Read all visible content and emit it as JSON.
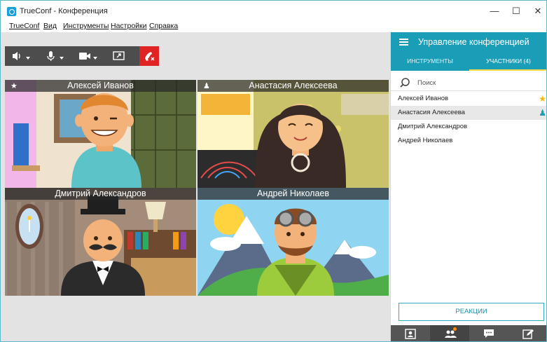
{
  "window": {
    "title": "TrueConf - Конференция",
    "controls": [
      "—",
      "☐",
      "✕"
    ]
  },
  "menu": [
    "TrueConf",
    "Вид",
    "Инструменты",
    "Настройки",
    "Справка"
  ],
  "toolbar": {
    "buttons": [
      "speaker-icon",
      "microphone-icon",
      "camera-icon",
      "screen-share-icon"
    ],
    "hangup": "hangup-icon"
  },
  "tiles": [
    {
      "name": "Алексей Иванов",
      "badge": "★"
    },
    {
      "name": "Анастасия Алексеева",
      "badge": "♟"
    },
    {
      "name": "Дмитрий Александров",
      "badge": ""
    },
    {
      "name": "Андрей Николаев",
      "badge": ""
    }
  ],
  "panel": {
    "title": "Управление конференцией",
    "tabs": [
      {
        "label": "ИНСТРУМЕНТЫ",
        "active": false
      },
      {
        "label": "УЧАСТНИКИ (4)",
        "active": true
      }
    ],
    "search_placeholder": "Поиск",
    "participants": [
      {
        "name": "Алексей Иванов",
        "badge": "★",
        "badge_color": "#f5b800"
      },
      {
        "name": "Анастасия Алексеева",
        "badge": "♟",
        "badge_color": "#1a9db7"
      },
      {
        "name": "Дмитрий Александров",
        "badge": ""
      },
      {
        "name": "Андрей Николаев",
        "badge": ""
      }
    ],
    "reactions_label": "РЕАКЦИИ",
    "bottom_icons": [
      "contact-card-icon",
      "participants-icon",
      "chat-icon",
      "edit-icon"
    ]
  },
  "colors": {
    "accent": "#1a9db7",
    "hangup": "#e02424",
    "toolbar": "#4d4d4d",
    "active_tab_underline": "#ffd84a"
  }
}
